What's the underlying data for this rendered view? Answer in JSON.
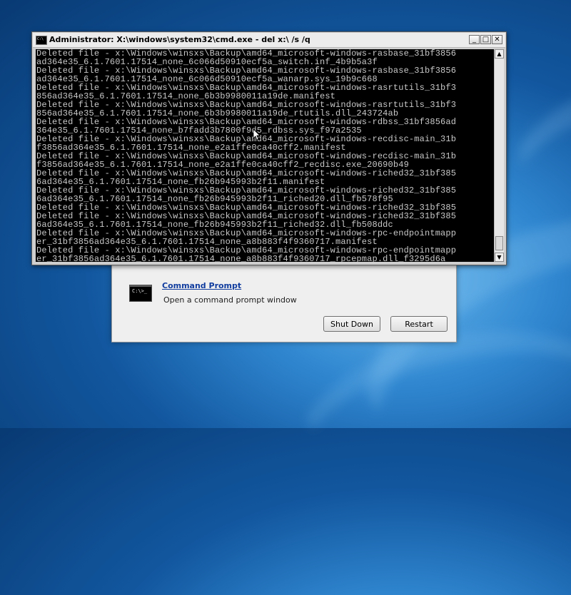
{
  "recovery": {
    "icon_name": "command-prompt-icon",
    "icon_glyph": "C:\\>_",
    "link_label": "Command Prompt",
    "description": "Open a command prompt window",
    "shutdown_label": "Shut Down",
    "restart_label": "Restart"
  },
  "cmd": {
    "title": "Administrator: X:\\windows\\system32\\cmd.exe - del x:\\ /s /q",
    "icon_glyph": "C:\\",
    "controls": {
      "minimize": "_",
      "maximize": "□",
      "close": "✕"
    },
    "scroll_up": "▲",
    "scroll_down": "▼",
    "lines": [
      "Deleted file - x:\\Windows\\winsxs\\Backup\\amd64_microsoft-windows-rasbase_31bf3856",
      "ad364e35_6.1.7601.17514_none_6c066d50910ecf5a_switch.inf_4b9b5a3f",
      "Deleted file - x:\\Windows\\winsxs\\Backup\\amd64_microsoft-windows-rasbase_31bf3856",
      "ad364e35_6.1.7601.17514_none_6c066d50910ecf5a_wanarp.sys_19b9c668",
      "Deleted file - x:\\Windows\\winsxs\\Backup\\amd64_microsoft-windows-rasrtutils_31bf3",
      "856ad364e35_6.1.7601.17514_none_6b3b9980011a19de.manifest",
      "Deleted file - x:\\Windows\\winsxs\\Backup\\amd64_microsoft-windows-rasrtutils_31bf3",
      "856ad364e35_6.1.7601.17514_none_6b3b9980011a19de_rtutils.dll_243724ab",
      "Deleted file - x:\\Windows\\winsxs\\Backup\\amd64_microsoft-windows-rdbss_31bf3856ad",
      "364e35_6.1.7601.17514_none_b7fadd3b7800f9d5_rdbss.sys_f97a2535",
      "Deleted file - x:\\Windows\\winsxs\\Backup\\amd64_microsoft-windows-recdisc-main_31b",
      "f3856ad364e35_6.1.7601.17514_none_e2a1ffe0ca40cff2.manifest",
      "Deleted file - x:\\Windows\\winsxs\\Backup\\amd64_microsoft-windows-recdisc-main_31b",
      "f3856ad364e35_6.1.7601.17514_none_e2a1ffe0ca40cff2_recdisc.exe_20690b49",
      "Deleted file - x:\\Windows\\winsxs\\Backup\\amd64_microsoft-windows-riched32_31bf385",
      "6ad364e35_6.1.7601.17514_none_fb26b945993b2f11.manifest",
      "Deleted file - x:\\Windows\\winsxs\\Backup\\amd64_microsoft-windows-riched32_31bf385",
      "6ad364e35_6.1.7601.17514_none_fb26b945993b2f11_riched20.dll_fb578f95",
      "Deleted file - x:\\Windows\\winsxs\\Backup\\amd64_microsoft-windows-riched32_31bf385",
      "Deleted file - x:\\Windows\\winsxs\\Backup\\amd64_microsoft-windows-riched32_31bf385",
      "6ad364e35_6.1.7601.17514_none_fb26b945993b2f11_riched32.dll_fb508ddc",
      "Deleted file - x:\\Windows\\winsxs\\Backup\\amd64_microsoft-windows-rpc-endpointmapp",
      "er_31bf3856ad364e35_6.1.7601.17514_none_a8b883f4f9360717.manifest",
      "Deleted file - x:\\Windows\\winsxs\\Backup\\amd64_microsoft-windows-rpc-endpointmapp",
      "er_31bf3856ad364e35_6.1.7601.17514_none_a8b883f4f9360717_rpcepmap.dll_f3295d6a"
    ]
  }
}
